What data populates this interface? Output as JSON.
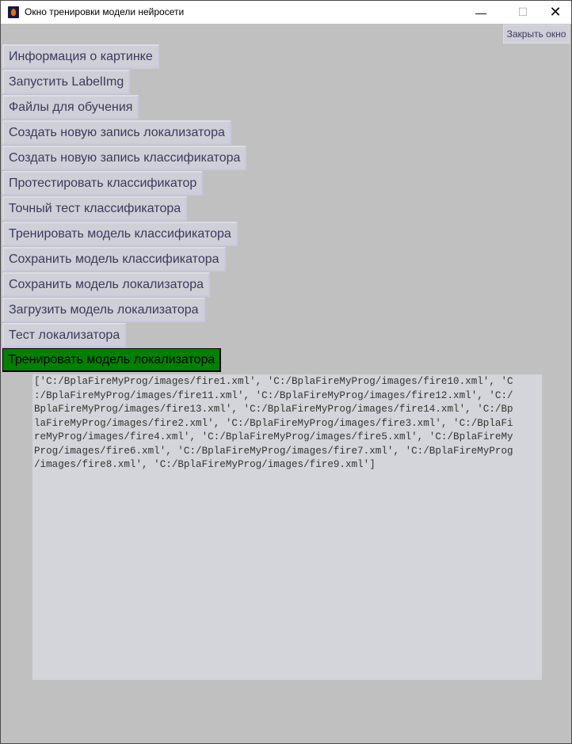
{
  "window": {
    "title": "Окно тренировки модели нейросети",
    "minimize": "—",
    "maximize": "☐",
    "close": "✕"
  },
  "close_button": "Закрыть окно",
  "buttons": [
    "Информация о картинке",
    "Запустить LabelImg",
    "Файлы для обучения",
    "Создать новую запись локализатора",
    "Создать новую запись классификатора",
    "Протестировать классификатор",
    "Точный тест классификатора",
    "Тренировать модель классификатора",
    "Сохранить модель классификатора",
    "Сохранить модель локализатора",
    "Загрузить модель локализатора",
    "Тест локализатора",
    "Тренировать модель локализатора"
  ],
  "active_button_color": "#008000",
  "output_lines": [
    "['C:/BplaFireMyProg/images/fire1.xml', 'C:/BplaFireMyProg/images/fire10.xml', 'C",
    ":/BplaFireMyProg/images/fire11.xml', 'C:/BplaFireMyProg/images/fire12.xml', 'C:/",
    "BplaFireMyProg/images/fire13.xml', 'C:/BplaFireMyProg/images/fire14.xml', 'C:/Bp",
    "laFireMyProg/images/fire2.xml', 'C:/BplaFireMyProg/images/fire3.xml', 'C:/BplaFi",
    "reMyProg/images/fire4.xml', 'C:/BplaFireMyProg/images/fire5.xml', 'C:/BplaFireMy",
    "Prog/images/fire6.xml', 'C:/BplaFireMyProg/images/fire7.xml', 'C:/BplaFireMyProg",
    "/images/fire8.xml', 'C:/BplaFireMyProg/images/fire9.xml']"
  ]
}
